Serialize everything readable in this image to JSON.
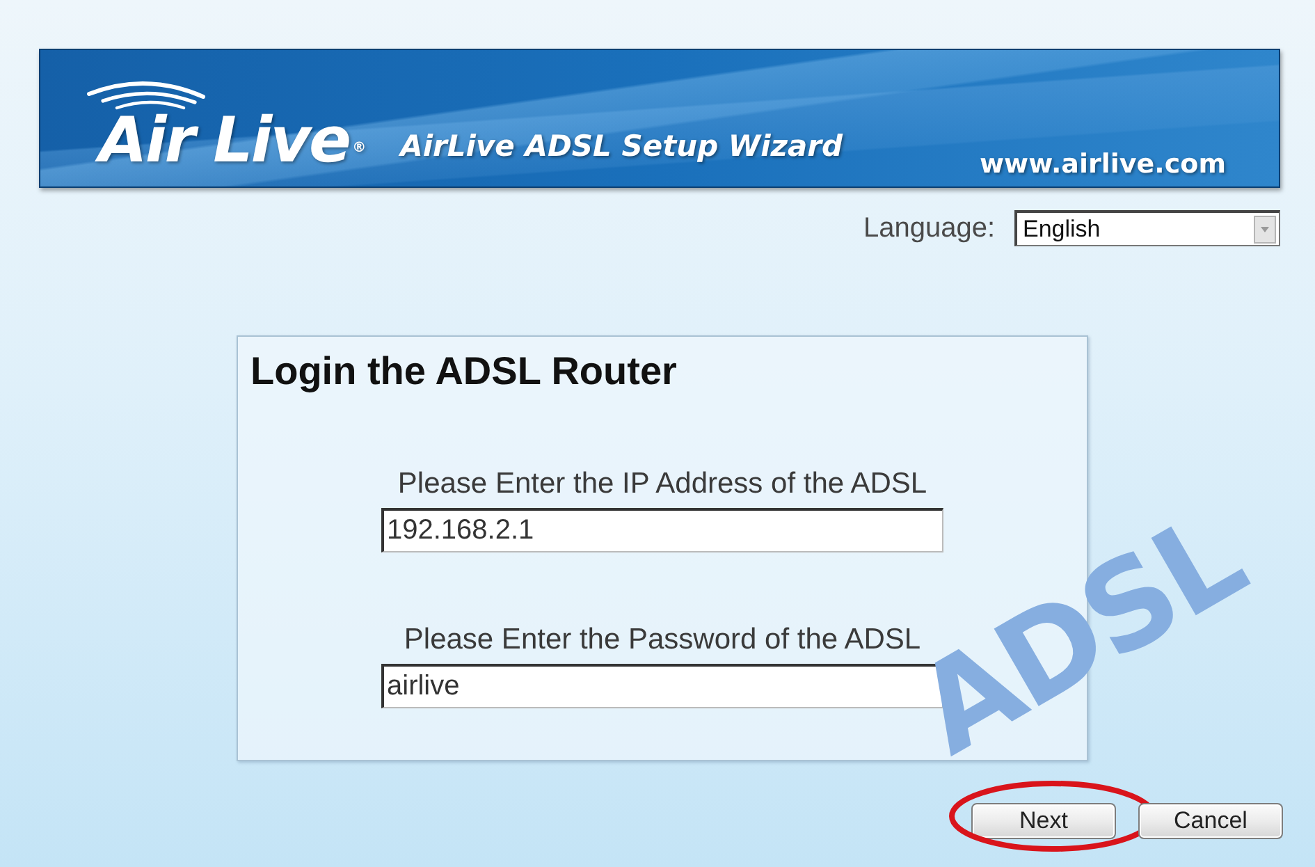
{
  "banner": {
    "logo": "Air Live$^{®}$",
    "title": "AirLive ADSL Setup Wizard",
    "website": "www.airlive.com"
  },
  "language": {
    "label": "Language:",
    "value": "English"
  },
  "background_lettering": "ADSL",
  "login_panel": {
    "title": "Login the ADSL Router",
    "fields": [
      {
        "label": "Please Enter the IP Address of the ADSL",
        "value": "192.168.2.1"
      },
      {
        "label": "Please Enter the Password of the ADSL",
        "value": "airlive"
      }
    ]
  },
  "buttons": [
    {
      "label": "Next",
      "highlighted": true
    },
    {
      "label": "Cancel",
      "highlighted": false
    }
  ]
}
